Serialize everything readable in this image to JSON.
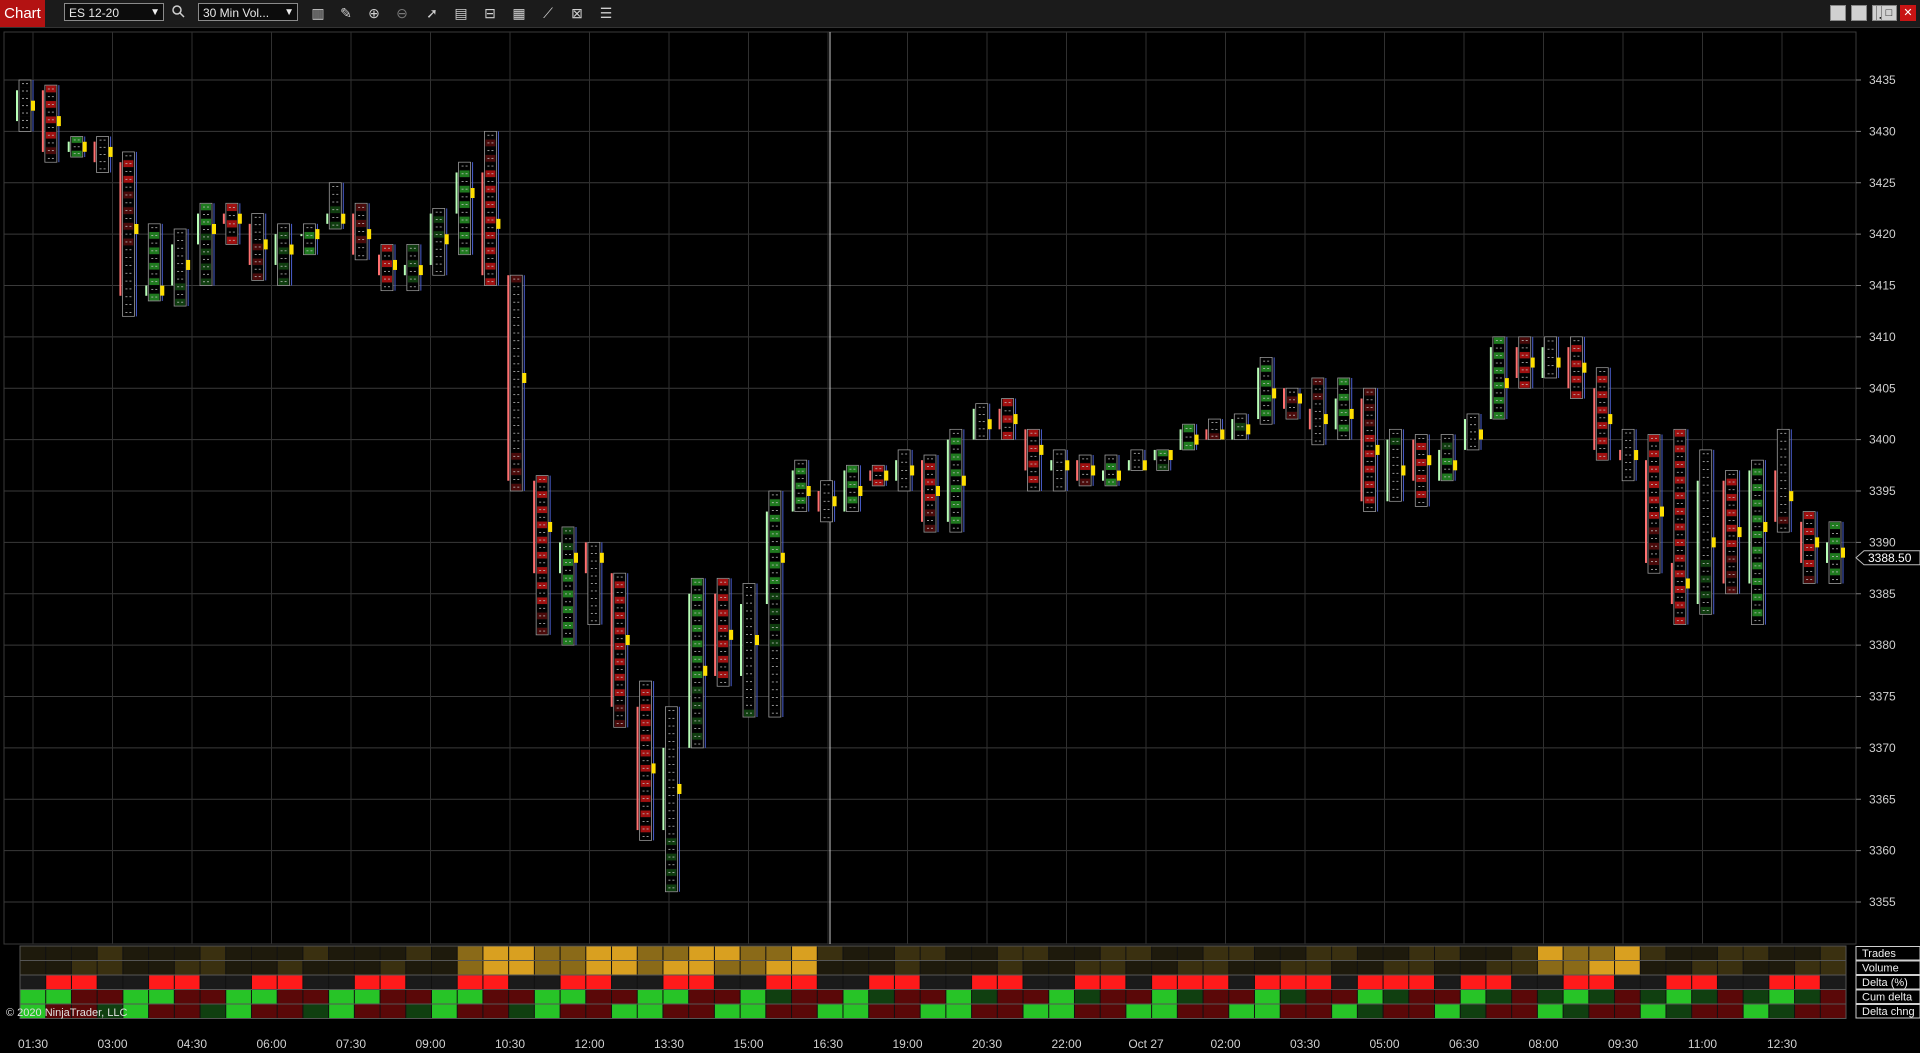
{
  "toolbar": {
    "title": "Chart",
    "instrument": "ES 12-20",
    "interval": "30 Min Vol...",
    "icons": [
      "search-icon",
      "bars-icon",
      "pencil-icon",
      "zoom-in-icon",
      "zoom-out-icon",
      "pointer-icon",
      "data-box-icon",
      "properties-icon",
      "chart-style-icon",
      "indicators-icon",
      "strategies-icon",
      "list-icon"
    ]
  },
  "window_controls": [
    "tile-icon",
    "tile-icon",
    "minimize-icon",
    "maximize-icon",
    "close-icon"
  ],
  "copyright": "© 2020 NinjaTrader, LLC",
  "colors": {
    "background": "#000000",
    "grid": "#3a3a3a",
    "bull": "#2bd62b",
    "bear": "#ff1a1a",
    "poc": "#ffe000",
    "price_marker": "#ffffff",
    "trades_volume": "#d9a020"
  },
  "chart_data": {
    "type": "candlestick",
    "instrument": "ES 12-20",
    "interval": "30 Min Vol...",
    "y_axis": {
      "min": 3355,
      "max": 3435,
      "ticks": [
        3435,
        3430,
        3425,
        3420,
        3415,
        3410,
        3405,
        3400,
        3395,
        3390,
        3385,
        3380,
        3375,
        3370,
        3365,
        3360,
        3355
      ]
    },
    "x_ticks": [
      "01:30",
      "03:00",
      "04:30",
      "06:00",
      "07:30",
      "09:00",
      "10:30",
      "12:00",
      "13:30",
      "15:00",
      "16:30",
      "19:00",
      "20:30",
      "22:00",
      "Oct 27",
      "02:00",
      "03:30",
      "05:00",
      "06:30",
      "08:00",
      "09:30",
      "11:00",
      "12:30"
    ],
    "last_price": "3388.50",
    "bars": [
      {
        "o": 3431,
        "h": 3435,
        "l": 3430,
        "c": 3434
      },
      {
        "o": 3434,
        "h": 3434.5,
        "l": 3427,
        "c": 3428
      },
      {
        "o": 3428,
        "h": 3429.5,
        "l": 3427.5,
        "c": 3429
      },
      {
        "o": 3429,
        "h": 3429.5,
        "l": 3426,
        "c": 3427
      },
      {
        "o": 3427,
        "h": 3428,
        "l": 3412,
        "c": 3414
      },
      {
        "o": 3414,
        "h": 3421,
        "l": 3413.5,
        "c": 3415
      },
      {
        "o": 3415,
        "h": 3420.5,
        "l": 3413,
        "c": 3419
      },
      {
        "o": 3419,
        "h": 3423,
        "l": 3415,
        "c": 3422
      },
      {
        "o": 3422,
        "h": 3423,
        "l": 3419,
        "c": 3421
      },
      {
        "o": 3421,
        "h": 3422,
        "l": 3415.5,
        "c": 3417
      },
      {
        "o": 3417,
        "h": 3421,
        "l": 3415,
        "c": 3420
      },
      {
        "o": 3420,
        "h": 3421,
        "l": 3418,
        "c": 3420
      },
      {
        "o": 3421,
        "h": 3425,
        "l": 3420.5,
        "c": 3422
      },
      {
        "o": 3422,
        "h": 3423,
        "l": 3417.5,
        "c": 3418
      },
      {
        "o": 3418,
        "h": 3419,
        "l": 3414.5,
        "c": 3416
      },
      {
        "o": 3416,
        "h": 3419,
        "l": 3414.5,
        "c": 3417
      },
      {
        "o": 3417,
        "h": 3422.5,
        "l": 3416,
        "c": 3422
      },
      {
        "o": 3422,
        "h": 3427,
        "l": 3418,
        "c": 3426
      },
      {
        "o": 3426,
        "h": 3430,
        "l": 3415,
        "c": 3416
      },
      {
        "o": 3416,
        "h": 3416,
        "l": 3395,
        "c": 3396
      },
      {
        "o": 3396,
        "h": 3396.5,
        "l": 3381,
        "c": 3387
      },
      {
        "o": 3387,
        "h": 3391.5,
        "l": 3380,
        "c": 3390
      },
      {
        "o": 3390,
        "h": 3388,
        "l": 3382,
        "c": 3387
      },
      {
        "o": 3387,
        "h": 3386,
        "l": 3372,
        "c": 3374
      },
      {
        "o": 3374,
        "h": 3376.5,
        "l": 3361,
        "c": 3362
      },
      {
        "o": 3362,
        "h": 3374,
        "l": 3356,
        "c": 3370
      },
      {
        "o": 3370,
        "h": 3386.5,
        "l": 3371,
        "c": 3385
      },
      {
        "o": 3385,
        "h": 3386.5,
        "l": 3376,
        "c": 3377
      },
      {
        "o": 3377,
        "h": 3386,
        "l": 3373,
        "c": 3384
      },
      {
        "o": 3384,
        "h": 3395,
        "l": 3373,
        "c": 3393
      },
      {
        "o": 3393,
        "h": 3398,
        "l": 3393,
        "c": 3397
      },
      {
        "o": 3395,
        "h": 3396,
        "l": 3392,
        "c": 3393
      },
      {
        "o": 3393,
        "h": 3397.5,
        "l": 3393,
        "c": 3397
      },
      {
        "o": 3397,
        "h": 3397.5,
        "l": 3395.5,
        "c": 3396
      },
      {
        "o": 3396,
        "h": 3399,
        "l": 3395,
        "c": 3398
      },
      {
        "o": 3398,
        "h": 3398.5,
        "l": 3391,
        "c": 3392
      },
      {
        "o": 3392,
        "h": 3401,
        "l": 3391,
        "c": 3400
      },
      {
        "o": 3400,
        "h": 3403.5,
        "l": 3401,
        "c": 3403
      },
      {
        "o": 3403,
        "h": 3404,
        "l": 3400,
        "c": 3401
      },
      {
        "o": 3401,
        "h": 3400,
        "l": 3395,
        "c": 3397
      },
      {
        "o": 3397,
        "h": 3399,
        "l": 3395,
        "c": 3398
      },
      {
        "o": 3398,
        "h": 3398.5,
        "l": 3395.5,
        "c": 3396
      },
      {
        "o": 3396,
        "h": 3398.5,
        "l": 3395.5,
        "c": 3397
      },
      {
        "o": 3397,
        "h": 3399,
        "l": 3397,
        "c": 3398
      },
      {
        "o": 3398,
        "h": 3399,
        "l": 3397,
        "c": 3399
      },
      {
        "o": 3399,
        "h": 3401.5,
        "l": 3399,
        "c": 3401
      },
      {
        "o": 3401,
        "h": 3402,
        "l": 3400,
        "c": 3400
      },
      {
        "o": 3400,
        "h": 3402.5,
        "l": 3400.5,
        "c": 3402
      },
      {
        "o": 3402,
        "h": 3408,
        "l": 3401.5,
        "c": 3407
      },
      {
        "o": 3405,
        "h": 3405,
        "l": 3402,
        "c": 3403
      },
      {
        "o": 3403,
        "h": 3406,
        "l": 3399.5,
        "c": 3401
      },
      {
        "o": 3401,
        "h": 3406,
        "l": 3400,
        "c": 3404
      },
      {
        "o": 3404,
        "h": 3405,
        "l": 3393,
        "c": 3394
      },
      {
        "o": 3394,
        "h": 3401,
        "l": 3395,
        "c": 3400
      },
      {
        "o": 3400,
        "h": 3400.5,
        "l": 3393.5,
        "c": 3396
      },
      {
        "o": 3396,
        "h": 3400.5,
        "l": 3397,
        "c": 3399
      },
      {
        "o": 3399,
        "h": 3402.5,
        "l": 3399,
        "c": 3402
      },
      {
        "o": 3402,
        "h": 3410,
        "l": 3402,
        "c": 3409
      },
      {
        "o": 3409,
        "h": 3410,
        "l": 3405,
        "c": 3406
      },
      {
        "o": 3406,
        "h": 3410,
        "l": 3408,
        "c": 3409
      },
      {
        "o": 3409,
        "h": 3410,
        "l": 3404,
        "c": 3405
      },
      {
        "o": 3405,
        "h": 3407,
        "l": 3398,
        "c": 3399
      },
      {
        "o": 3399,
        "h": 3401,
        "l": 3396,
        "c": 3398
      },
      {
        "o": 3398,
        "h": 3400.5,
        "l": 3387,
        "c": 3388
      },
      {
        "o": 3388,
        "h": 3401,
        "l": 3382,
        "c": 3384
      },
      {
        "o": 3384,
        "h": 3399,
        "l": 3383,
        "c": 3396
      },
      {
        "o": 3396,
        "h": 3397,
        "l": 3385,
        "c": 3386
      },
      {
        "o": 3386,
        "h": 3398,
        "l": 3382,
        "c": 3397
      },
      {
        "o": 3397,
        "h": 3401,
        "l": 3391,
        "c": 3392
      },
      {
        "o": 3392,
        "h": 3393,
        "l": 3386,
        "c": 3388
      },
      {
        "o": 3388,
        "h": 3392,
        "l": 3386,
        "c": 3390
      }
    ],
    "panel": {
      "rows": [
        "Trades",
        "Volume",
        "Delta (%)",
        "Cum delta",
        "Delta chng"
      ]
    }
  }
}
